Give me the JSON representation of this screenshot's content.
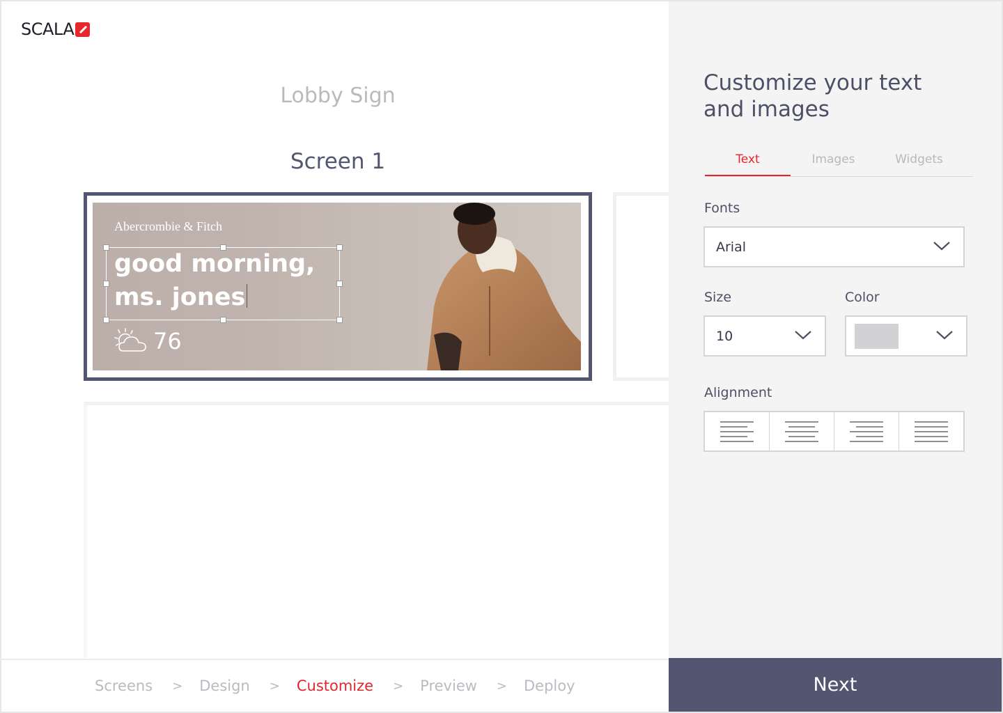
{
  "app": {
    "logo_text": "SCALA"
  },
  "canvas": {
    "project_title": "Lobby Sign",
    "screen_title": "Screen 1",
    "sign": {
      "brand": "Abercrombie & Fitch",
      "greeting_line1": "good morning,",
      "greeting_line2": "ms. jones",
      "temperature": "76",
      "weather_icon": "partly-sunny-icon"
    }
  },
  "breadcrumb": {
    "steps": [
      "Screens",
      "Design",
      "Customize",
      "Preview",
      "Deploy"
    ],
    "separator": ">",
    "active_step": "Customize"
  },
  "panel": {
    "title": "Customize your text and images",
    "tabs": [
      "Text",
      "Images",
      "Widgets"
    ],
    "active_tab": "Text",
    "fonts_label": "Fonts",
    "font_value": "Arial",
    "size_label": "Size",
    "size_value": "10",
    "color_label": "Color",
    "color_value": "#d2d2d4",
    "alignment_label": "Alignment",
    "alignment_options": [
      "align-left-icon",
      "align-center-icon",
      "align-right-icon",
      "align-justify-icon"
    ]
  },
  "next_button": {
    "label": "Next"
  },
  "colors": {
    "accent": "#e4262c",
    "primary": "#525670",
    "panel_bg": "#f4f4f4"
  }
}
